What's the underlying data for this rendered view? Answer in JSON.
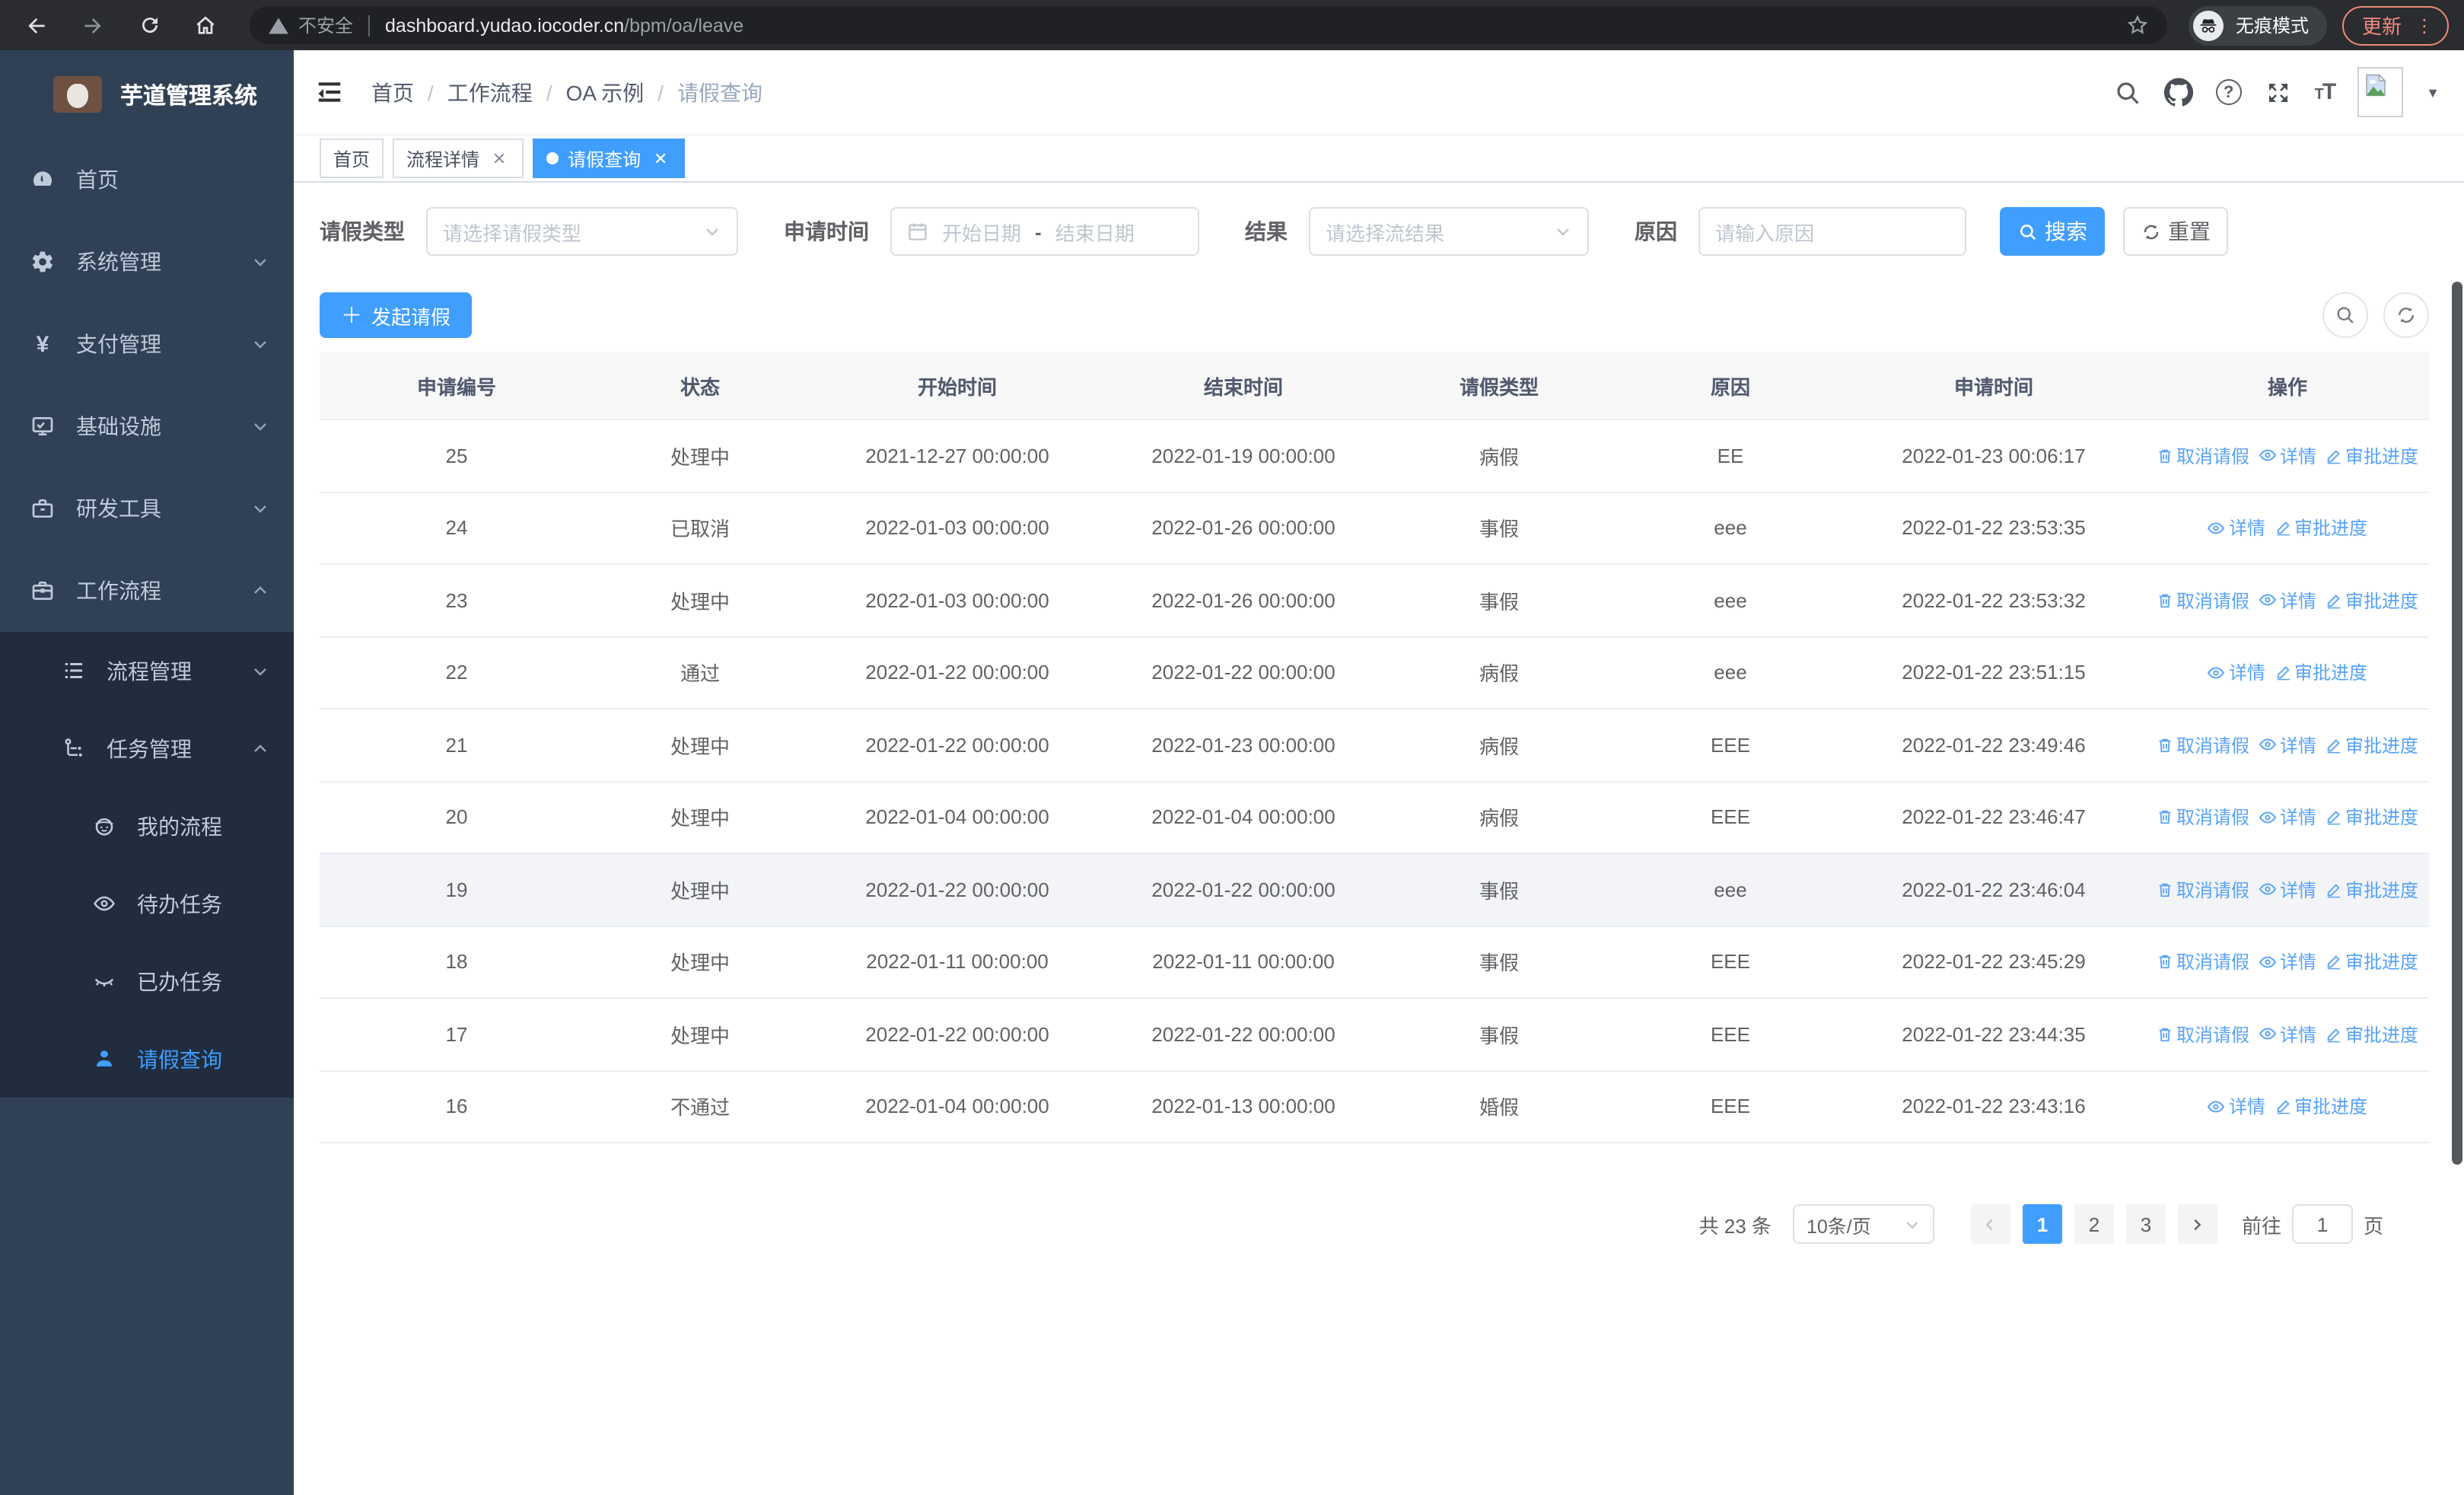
{
  "browser": {
    "security_label": "不安全",
    "url_host": "dashboard.yudao.iocoder.cn",
    "url_path": "/bpm/oa/leave",
    "incognito_label": "无痕模式",
    "update_label": "更新"
  },
  "sidebar": {
    "app_title": "芋道管理系统",
    "items": {
      "home": "首页",
      "system": "系统管理",
      "pay": "支付管理",
      "infra": "基础设施",
      "dev": "研发工具",
      "workflow": "工作流程",
      "process": "流程管理",
      "task": "任务管理",
      "my_process": "我的流程",
      "todo": "待办任务",
      "done": "已办任务",
      "leave_query": "请假查询"
    }
  },
  "breadcrumb": {
    "items": [
      "首页",
      "工作流程",
      "OA 示例",
      "请假查询"
    ]
  },
  "tags": {
    "home": "首页",
    "detail": "流程详情",
    "leave": "请假查询"
  },
  "filters": {
    "type_label": "请假类型",
    "type_placeholder": "请选择请假类型",
    "time_label": "申请时间",
    "start_placeholder": "开始日期",
    "range_separator": "-",
    "end_placeholder": "结束日期",
    "result_label": "结果",
    "result_placeholder": "请选择流结果",
    "reason_label": "原因",
    "reason_placeholder": "请输入原因",
    "search_label": "搜索",
    "reset_label": "重置"
  },
  "toolbar": {
    "create_label": "发起请假"
  },
  "table": {
    "columns": [
      "申请编号",
      "状态",
      "开始时间",
      "结束时间",
      "请假类型",
      "原因",
      "申请时间",
      "操作"
    ],
    "action_labels": {
      "cancel": "取消请假",
      "detail": "详情",
      "progress": "审批进度"
    },
    "rows": [
      {
        "id": "25",
        "status": "处理中",
        "start": "2021-12-27 00:00:00",
        "end": "2022-01-19 00:00:00",
        "type": "病假",
        "reason": "EE",
        "apply_time": "2022-01-23 00:06:17",
        "actions": [
          "cancel",
          "detail",
          "progress"
        ],
        "highlight": false
      },
      {
        "id": "24",
        "status": "已取消",
        "start": "2022-01-03 00:00:00",
        "end": "2022-01-26 00:00:00",
        "type": "事假",
        "reason": "eee",
        "apply_time": "2022-01-22 23:53:35",
        "actions": [
          "detail",
          "progress"
        ],
        "highlight": false
      },
      {
        "id": "23",
        "status": "处理中",
        "start": "2022-01-03 00:00:00",
        "end": "2022-01-26 00:00:00",
        "type": "事假",
        "reason": "eee",
        "apply_time": "2022-01-22 23:53:32",
        "actions": [
          "cancel",
          "detail",
          "progress"
        ],
        "highlight": false
      },
      {
        "id": "22",
        "status": "通过",
        "start": "2022-01-22 00:00:00",
        "end": "2022-01-22 00:00:00",
        "type": "病假",
        "reason": "eee",
        "apply_time": "2022-01-22 23:51:15",
        "actions": [
          "detail",
          "progress"
        ],
        "highlight": false
      },
      {
        "id": "21",
        "status": "处理中",
        "start": "2022-01-22 00:00:00",
        "end": "2022-01-23 00:00:00",
        "type": "病假",
        "reason": "EEE",
        "apply_time": "2022-01-22 23:49:46",
        "actions": [
          "cancel",
          "detail",
          "progress"
        ],
        "highlight": false
      },
      {
        "id": "20",
        "status": "处理中",
        "start": "2022-01-04 00:00:00",
        "end": "2022-01-04 00:00:00",
        "type": "病假",
        "reason": "EEE",
        "apply_time": "2022-01-22 23:46:47",
        "actions": [
          "cancel",
          "detail",
          "progress"
        ],
        "highlight": false
      },
      {
        "id": "19",
        "status": "处理中",
        "start": "2022-01-22 00:00:00",
        "end": "2022-01-22 00:00:00",
        "type": "事假",
        "reason": "eee",
        "apply_time": "2022-01-22 23:46:04",
        "actions": [
          "cancel",
          "detail",
          "progress"
        ],
        "highlight": true
      },
      {
        "id": "18",
        "status": "处理中",
        "start": "2022-01-11 00:00:00",
        "end": "2022-01-11 00:00:00",
        "type": "事假",
        "reason": "EEE",
        "apply_time": "2022-01-22 23:45:29",
        "actions": [
          "cancel",
          "detail",
          "progress"
        ],
        "highlight": false
      },
      {
        "id": "17",
        "status": "处理中",
        "start": "2022-01-22 00:00:00",
        "end": "2022-01-22 00:00:00",
        "type": "事假",
        "reason": "EEE",
        "apply_time": "2022-01-22 23:44:35",
        "actions": [
          "cancel",
          "detail",
          "progress"
        ],
        "highlight": false
      },
      {
        "id": "16",
        "status": "不通过",
        "start": "2022-01-04 00:00:00",
        "end": "2022-01-13 00:00:00",
        "type": "婚假",
        "reason": "EEE",
        "apply_time": "2022-01-22 23:43:16",
        "actions": [
          "detail",
          "progress"
        ],
        "highlight": false
      }
    ]
  },
  "pagination": {
    "total": "共 23 条",
    "page_size": "10条/页",
    "pages": [
      "1",
      "2",
      "3"
    ],
    "active_page": "1",
    "goto_label": "前往",
    "goto_value": "1",
    "goto_suffix": "页"
  },
  "colors": {
    "primary": "#409EFF",
    "action_link": "#58a3f8",
    "sidebar_bg": "#304156",
    "submenu_bg": "#212d3e",
    "update_accent": "#f28b82"
  }
}
